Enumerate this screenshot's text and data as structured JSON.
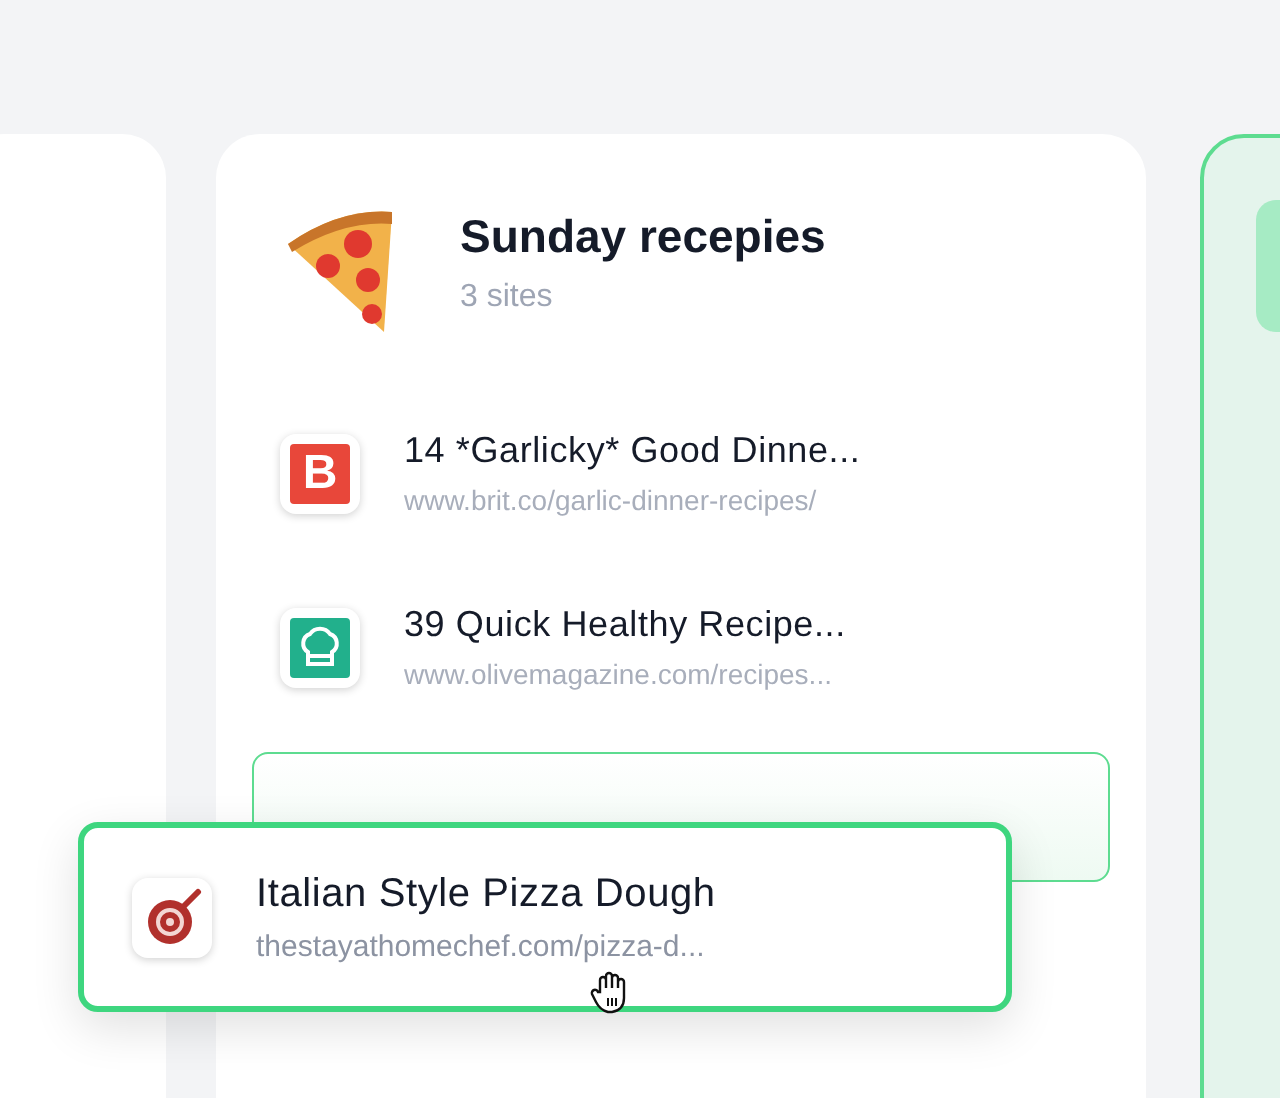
{
  "collection": {
    "title": "Sunday recepies",
    "subtitle": "3 sites"
  },
  "sites": [
    {
      "kind": "letter",
      "logo_text": "B",
      "title": "14 *Garlicky* Good Dinne...",
      "url": "www.brit.co/garlic-dinner-recipes/"
    },
    {
      "kind": "chef-hat",
      "title": "39 Quick Healthy Recipe...",
      "url": "www.olivemagazine.com/recipes..."
    }
  ],
  "dragged": {
    "kind": "pan",
    "title": "Italian Style Pizza Dough",
    "url": "thestayathomechef.com/pizza-d..."
  }
}
